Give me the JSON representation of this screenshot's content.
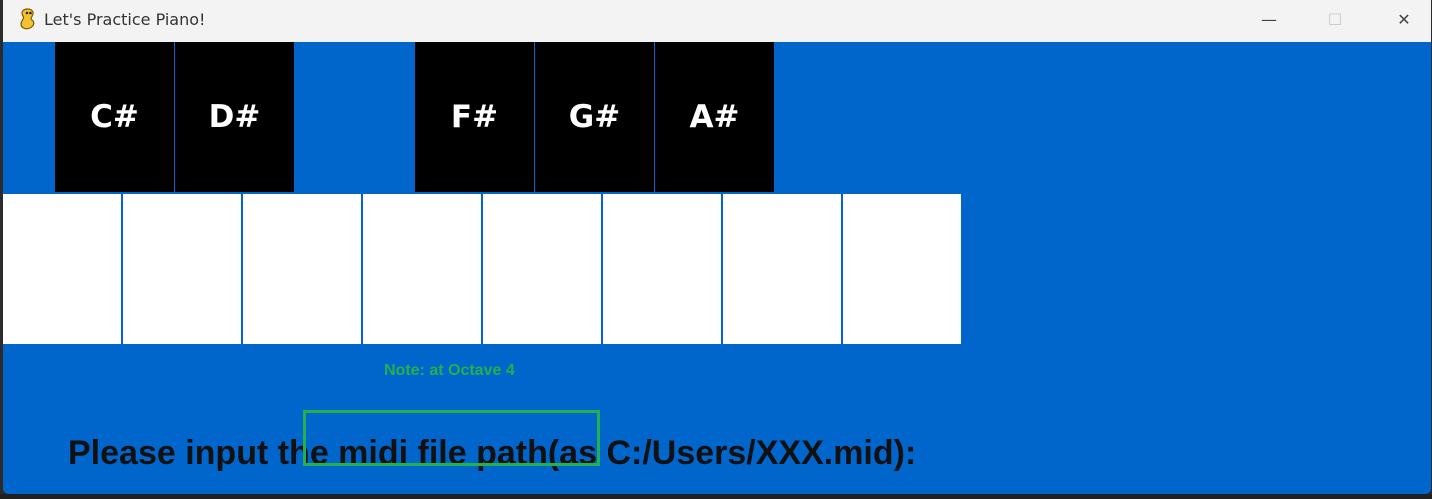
{
  "window": {
    "title": "Let's Practice Piano!",
    "icon": "pygame-snake-icon",
    "controls": {
      "minimize": "—",
      "maximize": "☐",
      "close": "✕"
    }
  },
  "piano": {
    "black_keys": [
      "C#",
      "D#",
      "F#",
      "G#",
      "A#"
    ],
    "white_key_count": 8
  },
  "status": {
    "note_text": "Note:  at Octave 4"
  },
  "prompt": {
    "text": "Please input the midi file path(as C:/Users/XXX.mid):"
  },
  "colors": {
    "background": "#0066cc",
    "black_key": "#000000",
    "white_key": "#ffffff",
    "accent_green": "#22b14c",
    "prompt_text": "#111111"
  }
}
